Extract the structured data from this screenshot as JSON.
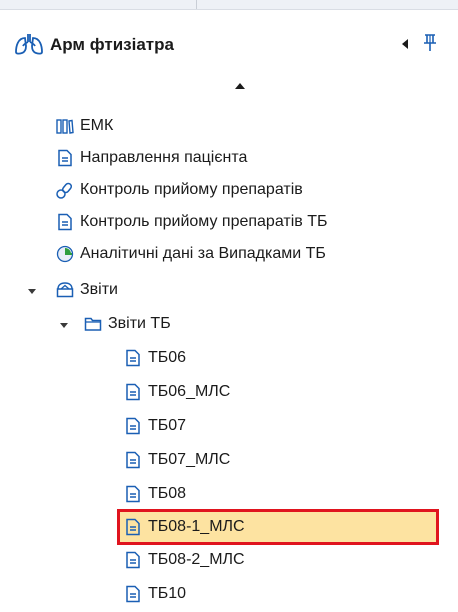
{
  "panel": {
    "title": "Арм фтизіатра",
    "icons": {
      "app": "lungs-icon",
      "collapse": "triangle-left-icon",
      "pin": "pin-icon",
      "scroll_up": "triangle-up-icon"
    }
  },
  "tree": {
    "items": [
      {
        "label": "ЕМК",
        "icon": "library-icon",
        "level": 1
      },
      {
        "label": "Направлення пацієнта",
        "icon": "document-icon",
        "level": 1
      },
      {
        "label": "Контроль прийому препаратів",
        "icon": "pills-icon",
        "level": 1
      },
      {
        "label": "Контроль прийому препаратів ТБ",
        "icon": "document-icon",
        "level": 1
      },
      {
        "label": "Аналітичні дані за Випадками ТБ",
        "icon": "chart-clock-icon",
        "level": 1
      },
      {
        "label": "Звіти",
        "icon": "reports-icon",
        "level": 1,
        "expanded": true
      },
      {
        "label": "Звіти ТБ",
        "icon": "folder-icon",
        "level": 2,
        "expanded": true
      },
      {
        "label": "ТБ06",
        "icon": "document-icon",
        "level": 3
      },
      {
        "label": "ТБ06_МЛС",
        "icon": "document-icon",
        "level": 3
      },
      {
        "label": "ТБ07",
        "icon": "document-icon",
        "level": 3
      },
      {
        "label": "ТБ07_МЛС",
        "icon": "document-icon",
        "level": 3
      },
      {
        "label": "ТБ08",
        "icon": "document-icon",
        "level": 3
      },
      {
        "label": "ТБ08-1_МЛС",
        "icon": "document-icon",
        "level": 3,
        "selected": true
      },
      {
        "label": "ТБ08-2_МЛС",
        "icon": "document-icon",
        "level": 3
      },
      {
        "label": "ТБ10",
        "icon": "document-icon",
        "level": 3
      }
    ]
  },
  "colors": {
    "icon_blue": "#1a5fb4",
    "selection_fill": "#fde3a1",
    "selection_border": "#e0141e"
  }
}
